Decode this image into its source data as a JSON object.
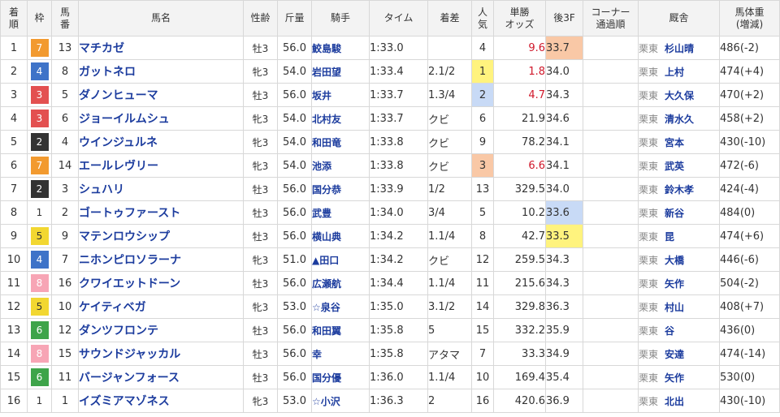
{
  "headers": {
    "rank": "着順",
    "waku": "枠",
    "num": "馬番",
    "name": "馬名",
    "sex_age": "性齢",
    "weight": "斤量",
    "jockey": "騎手",
    "time": "タイム",
    "margin": "着差",
    "popularity": "人気",
    "odds": "単勝オッズ",
    "last3f": "後3F",
    "corner": "コーナー通過順",
    "trainer": "厩舎",
    "body_weight": "馬体重(増減)"
  },
  "colors": {
    "waku_1": "#ffffff",
    "waku_2": "#333333",
    "waku_3": "#e35050",
    "waku_4": "#3e73c8",
    "waku_5": "#f2d731",
    "waku_6": "#3ea44a",
    "waku_7": "#f29a2f",
    "waku_8": "#f7a5b5",
    "popularity_1_bg": "#fff37e",
    "popularity_2_bg": "#c8daf6",
    "popularity_3_bg": "#f9c8a6",
    "odds_top3_text": "#d0182b",
    "link_text": "#1c3c9e"
  },
  "rows": [
    {
      "rank": "1",
      "waku": "7",
      "num": "13",
      "name": "マチカゼ",
      "sex_age": "牡3",
      "weight": "56.0",
      "jockey": "鮫島駿",
      "time": "1:33.0",
      "margin": "",
      "popularity": "4",
      "odds": "9.6",
      "last3f": "33.7",
      "corner": "",
      "loc": "栗東",
      "trainer": "杉山晴",
      "body_weight": "486(-2)",
      "popularity_highlight": "",
      "odds_red": true,
      "last3f_highlight": "3"
    },
    {
      "rank": "2",
      "waku": "4",
      "num": "8",
      "name": "ガットネロ",
      "sex_age": "牝3",
      "weight": "54.0",
      "jockey": "岩田望",
      "time": "1:33.4",
      "margin": "2.1/2",
      "popularity": "1",
      "odds": "1.8",
      "last3f": "34.0",
      "corner": "",
      "loc": "栗東",
      "trainer": "上村",
      "body_weight": "474(+4)",
      "popularity_highlight": "1",
      "odds_red": true,
      "last3f_highlight": ""
    },
    {
      "rank": "3",
      "waku": "3",
      "num": "5",
      "name": "ダノンヒューマ",
      "sex_age": "牡3",
      "weight": "56.0",
      "jockey": "坂井",
      "time": "1:33.7",
      "margin": "1.3/4",
      "popularity": "2",
      "odds": "4.7",
      "last3f": "34.3",
      "corner": "",
      "loc": "栗東",
      "trainer": "大久保",
      "body_weight": "470(+2)",
      "popularity_highlight": "2",
      "odds_red": true,
      "last3f_highlight": ""
    },
    {
      "rank": "4",
      "waku": "3",
      "num": "6",
      "name": "ジョーイルムシュ",
      "sex_age": "牝3",
      "weight": "54.0",
      "jockey": "北村友",
      "time": "1:33.7",
      "margin": "クビ",
      "popularity": "6",
      "odds": "21.9",
      "last3f": "34.6",
      "corner": "",
      "loc": "栗東",
      "trainer": "清水久",
      "body_weight": "458(+2)",
      "popularity_highlight": "",
      "odds_red": false,
      "last3f_highlight": ""
    },
    {
      "rank": "5",
      "waku": "2",
      "num": "4",
      "name": "ウインジュルネ",
      "sex_age": "牝3",
      "weight": "54.0",
      "jockey": "和田竜",
      "time": "1:33.8",
      "margin": "クビ",
      "popularity": "9",
      "odds": "78.2",
      "last3f": "34.1",
      "corner": "",
      "loc": "栗東",
      "trainer": "宮本",
      "body_weight": "430(-10)",
      "popularity_highlight": "",
      "odds_red": false,
      "last3f_highlight": ""
    },
    {
      "rank": "6",
      "waku": "7",
      "num": "14",
      "name": "エールレヴリー",
      "sex_age": "牝3",
      "weight": "54.0",
      "jockey": "池添",
      "time": "1:33.8",
      "margin": "クビ",
      "popularity": "3",
      "odds": "6.6",
      "last3f": "34.1",
      "corner": "",
      "loc": "栗東",
      "trainer": "武英",
      "body_weight": "472(-6)",
      "popularity_highlight": "3",
      "odds_red": true,
      "last3f_highlight": ""
    },
    {
      "rank": "7",
      "waku": "2",
      "num": "3",
      "name": "シュハリ",
      "sex_age": "牡3",
      "weight": "56.0",
      "jockey": "国分恭",
      "time": "1:33.9",
      "margin": "1/2",
      "popularity": "13",
      "odds": "329.5",
      "last3f": "34.0",
      "corner": "",
      "loc": "栗東",
      "trainer": "鈴木孝",
      "body_weight": "424(-4)",
      "popularity_highlight": "",
      "odds_red": false,
      "last3f_highlight": ""
    },
    {
      "rank": "8",
      "waku": "1",
      "num": "2",
      "name": "ゴートゥファースト",
      "sex_age": "牡3",
      "weight": "56.0",
      "jockey": "武豊",
      "time": "1:34.0",
      "margin": "3/4",
      "popularity": "5",
      "odds": "10.2",
      "last3f": "33.6",
      "corner": "",
      "loc": "栗東",
      "trainer": "新谷",
      "body_weight": "484(0)",
      "popularity_highlight": "",
      "odds_red": false,
      "last3f_highlight": "2"
    },
    {
      "rank": "9",
      "waku": "5",
      "num": "9",
      "name": "マテンロウシップ",
      "sex_age": "牡3",
      "weight": "56.0",
      "jockey": "横山典",
      "time": "1:34.2",
      "margin": "1.1/4",
      "popularity": "8",
      "odds": "42.7",
      "last3f": "33.5",
      "corner": "",
      "loc": "栗東",
      "trainer": "昆",
      "body_weight": "474(+6)",
      "popularity_highlight": "",
      "odds_red": false,
      "last3f_highlight": "1"
    },
    {
      "rank": "10",
      "waku": "4",
      "num": "7",
      "name": "ニホンピロソラーナ",
      "sex_age": "牝3",
      "weight": "51.0",
      "jockey": "▲田口",
      "time": "1:34.2",
      "margin": "クビ",
      "popularity": "12",
      "odds": "259.5",
      "last3f": "34.3",
      "corner": "",
      "loc": "栗東",
      "trainer": "大橋",
      "body_weight": "446(-6)",
      "popularity_highlight": "",
      "odds_red": false,
      "last3f_highlight": ""
    },
    {
      "rank": "11",
      "waku": "8",
      "num": "16",
      "name": "クワイエットドーン",
      "sex_age": "牡3",
      "weight": "56.0",
      "jockey": "広瀬航",
      "time": "1:34.4",
      "margin": "1.1/4",
      "popularity": "11",
      "odds": "215.6",
      "last3f": "34.3",
      "corner": "",
      "loc": "栗東",
      "trainer": "矢作",
      "body_weight": "504(-2)",
      "popularity_highlight": "",
      "odds_red": false,
      "last3f_highlight": ""
    },
    {
      "rank": "12",
      "waku": "5",
      "num": "10",
      "name": "ケイティベガ",
      "sex_age": "牝3",
      "weight": "53.0",
      "jockey": "☆泉谷",
      "time": "1:35.0",
      "margin": "3.1/2",
      "popularity": "14",
      "odds": "329.8",
      "last3f": "36.3",
      "corner": "",
      "loc": "栗東",
      "trainer": "村山",
      "body_weight": "408(+7)",
      "popularity_highlight": "",
      "odds_red": false,
      "last3f_highlight": ""
    },
    {
      "rank": "13",
      "waku": "6",
      "num": "12",
      "name": "ダンツフロンテ",
      "sex_age": "牡3",
      "weight": "56.0",
      "jockey": "和田翼",
      "time": "1:35.8",
      "margin": "5",
      "popularity": "15",
      "odds": "332.2",
      "last3f": "35.9",
      "corner": "",
      "loc": "栗東",
      "trainer": "谷",
      "body_weight": "436(0)",
      "popularity_highlight": "",
      "odds_red": false,
      "last3f_highlight": ""
    },
    {
      "rank": "14",
      "waku": "8",
      "num": "15",
      "name": "サウンドジャッカル",
      "sex_age": "牡3",
      "weight": "56.0",
      "jockey": "幸",
      "time": "1:35.8",
      "margin": "アタマ",
      "popularity": "7",
      "odds": "33.3",
      "last3f": "34.9",
      "corner": "",
      "loc": "栗東",
      "trainer": "安達",
      "body_weight": "474(-14)",
      "popularity_highlight": "",
      "odds_red": false,
      "last3f_highlight": ""
    },
    {
      "rank": "15",
      "waku": "6",
      "num": "11",
      "name": "バージャンフォース",
      "sex_age": "牡3",
      "weight": "56.0",
      "jockey": "国分優",
      "time": "1:36.0",
      "margin": "1.1/4",
      "popularity": "10",
      "odds": "169.4",
      "last3f": "35.4",
      "corner": "",
      "loc": "栗東",
      "trainer": "矢作",
      "body_weight": "530(0)",
      "popularity_highlight": "",
      "odds_red": false,
      "last3f_highlight": ""
    },
    {
      "rank": "16",
      "waku": "1",
      "num": "1",
      "name": "イズミアマゾネス",
      "sex_age": "牝3",
      "weight": "53.0",
      "jockey": "☆小沢",
      "time": "1:36.3",
      "margin": "2",
      "popularity": "16",
      "odds": "420.6",
      "last3f": "36.9",
      "corner": "",
      "loc": "栗東",
      "trainer": "北出",
      "body_weight": "430(-10)",
      "popularity_highlight": "",
      "odds_red": false,
      "last3f_highlight": ""
    }
  ]
}
